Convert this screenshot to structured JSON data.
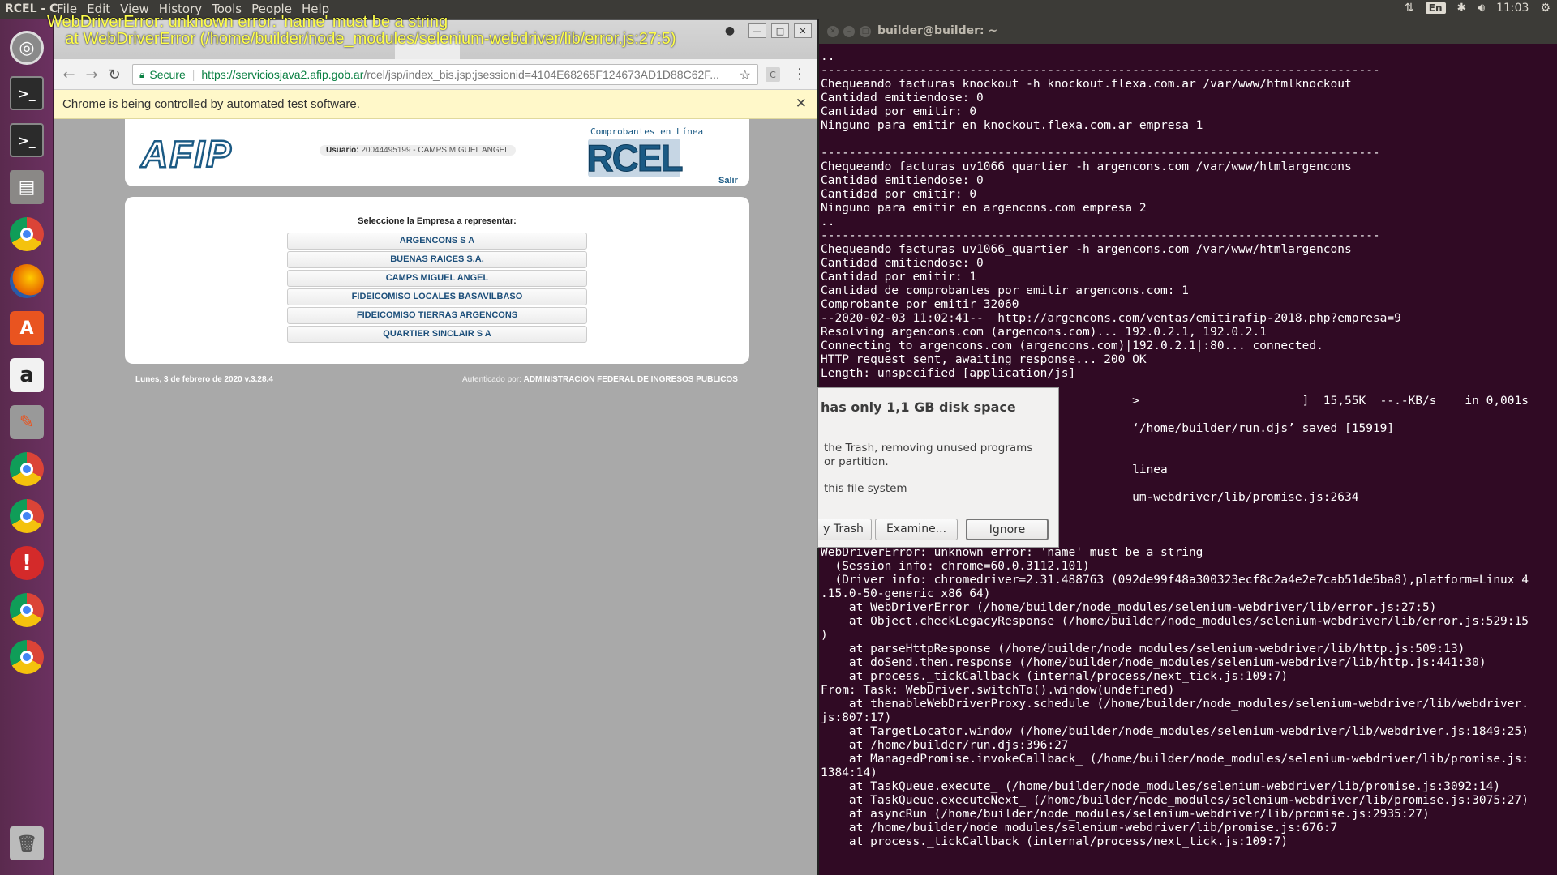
{
  "top_panel": {
    "app_title": "RCEL - C",
    "menus": [
      "File",
      "Edit",
      "View",
      "History",
      "Tools",
      "People",
      "Help"
    ],
    "lang": "En",
    "time": "11:03"
  },
  "error_overlay": {
    "line1": "WebDriverError: unknown error: 'name' must be a string",
    "line2": "    at WebDriverError (/home/builder/node_modules/selenium-webdriver/lib/error.js:27:5)"
  },
  "launcher": {
    "items": [
      "ubuntu-dash",
      "terminal",
      "terminal",
      "files",
      "chrome",
      "firefox",
      "software-center",
      "amazon",
      "system-settings",
      "chrome",
      "chrome",
      "update-notifier",
      "chrome",
      "chrome",
      "trash"
    ]
  },
  "browser": {
    "secure_label": "Secure",
    "url_host": "https://serviciosjava2.afip.gob.ar",
    "url_rest": "/rcel/jsp/index_bis.jsp;jsessionid=4104E68265F124673AD1D88C62F...",
    "ext_label": "C",
    "infobar_text": "Chrome is being controlled by automated test software."
  },
  "afip": {
    "logo": "AFIP",
    "user_label": "Usuario:",
    "user_value": "20044495199 - CAMPS MIGUEL ANGEL",
    "rcel_subtitle": "Comprobantes en Línea",
    "rcel_logo": "RCEL",
    "salir": "Salir",
    "select_title": "Seleccione la Empresa a representar:",
    "empresas": [
      "ARGENCONS S A",
      "BUENAS RAICES S.A.",
      "CAMPS MIGUEL ANGEL",
      "FIDEICOMISO LOCALES BASAVILBASO",
      "FIDEICOMISO TIERRAS ARGENCONS",
      "QUARTIER SINCLAIR S A"
    ],
    "footer_date": "Lunes, 3 de febrero de 2020 v.3.28.4",
    "footer_auth_label": "Autenticado por:",
    "footer_auth_value": "ADMINISTRACION FEDERAL DE INGRESOS PUBLICOS"
  },
  "terminal": {
    "title": "builder@builder: ~",
    "lines": [
      "..",
      "-------------------------------------------------------------------------------",
      "Chequeando facturas knockout -h knockout.flexa.com.ar /var/www/htmlknockout",
      "Cantidad emitiendose: 0",
      "Cantidad por emitir: 0",
      "Ninguno para emitir en knockout.flexa.com.ar empresa 1",
      "",
      "-------------------------------------------------------------------------------",
      "Chequeando facturas uv1066_quartier -h argencons.com /var/www/htmlargencons",
      "Cantidad emitiendose: 0",
      "Cantidad por emitir: 0",
      "Ninguno para emitir en argencons.com empresa 2",
      "..",
      "-------------------------------------------------------------------------------",
      "Chequeando facturas uv1066_quartier -h argencons.com /var/www/htmlargencons",
      "Cantidad emitiendose: 0",
      "Cantidad por emitir: 1",
      "Cantidad de comprobantes por emitir argencons.com: 1",
      "Comprobante por emitir 32060",
      "--2020-02-03 11:02:41--  http://argencons.com/ventas/emitirafip-2018.php?empresa=9",
      "Resolving argencons.com (argencons.com)... 192.0.2.1, 192.0.2.1",
      "Connecting to argencons.com (argencons.com)|192.0.2.1|:80... connected.",
      "HTTP request sent, awaiting response... 200 OK",
      "Length: unspecified [application/js]",
      "",
      "                                            >                       ]  15,55K  --.-KB/s    in 0,001s",
      "",
      "                                            ‘/home/builder/run.djs’ saved [15919]",
      "",
      "",
      "                                            linea",
      "",
      "                                            um-webdriver/lib/promise.js:2634",
      "",
      "",
      "",
      "WebDriverError: unknown error: 'name' must be a string",
      "  (Session info: chrome=60.0.3112.101)",
      "  (Driver info: chromedriver=2.31.488763 (092de99f48a300323ecf8c2a4e2e7cab51de5ba8),platform=Linux 4",
      ".15.0-50-generic x86_64)",
      "    at WebDriverError (/home/builder/node_modules/selenium-webdriver/lib/error.js:27:5)",
      "    at Object.checkLegacyResponse (/home/builder/node_modules/selenium-webdriver/lib/error.js:529:15",
      ")",
      "    at parseHttpResponse (/home/builder/node_modules/selenium-webdriver/lib/http.js:509:13)",
      "    at doSend.then.response (/home/builder/node_modules/selenium-webdriver/lib/http.js:441:30)",
      "    at process._tickCallback (internal/process/next_tick.js:109:7)",
      "From: Task: WebDriver.switchTo().window(undefined)",
      "    at thenableWebDriverProxy.schedule (/home/builder/node_modules/selenium-webdriver/lib/webdriver.",
      "js:807:17)",
      "    at TargetLocator.window (/home/builder/node_modules/selenium-webdriver/lib/webdriver.js:1849:25)",
      "    at /home/builder/run.djs:396:27",
      "    at ManagedPromise.invokeCallback_ (/home/builder/node_modules/selenium-webdriver/lib/promise.js:",
      "1384:14)",
      "    at TaskQueue.execute_ (/home/builder/node_modules/selenium-webdriver/lib/promise.js:3092:14)",
      "    at TaskQueue.executeNext_ (/home/builder/node_modules/selenium-webdriver/lib/promise.js:3075:27)",
      "    at asyncRun (/home/builder/node_modules/selenium-webdriver/lib/promise.js:2935:27)",
      "    at /home/builder/node_modules/selenium-webdriver/lib/promise.js:676:7",
      "    at process._tickCallback (internal/process/next_tick.js:109:7)"
    ]
  },
  "disk_dialog": {
    "title": "has only 1,1 GB disk space",
    "message": "the Trash, removing unused programs\nor partition.",
    "checkbox_label": "this file system",
    "btn_trash": "y Trash",
    "btn_examine": "Examine...",
    "btn_ignore": "Ignore"
  }
}
